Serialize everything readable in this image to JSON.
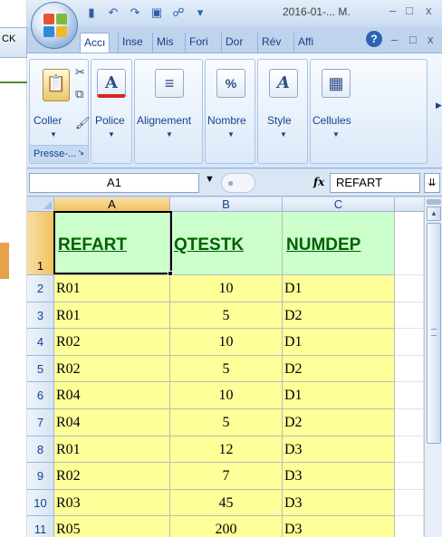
{
  "background": {
    "tab_label": "CK"
  },
  "titlebar": {
    "title": "2016-01-... M.",
    "qat_icons": [
      "save-icon",
      "undo-icon",
      "redo-icon",
      "view-icon",
      "print-preview-icon",
      "customize-icon"
    ],
    "controls": {
      "minimize": "–",
      "restore": "□",
      "close": "x"
    }
  },
  "ribbon_tabs": [
    {
      "label": "Accı",
      "active": true
    },
    {
      "label": "Inse"
    },
    {
      "label": "Mis"
    },
    {
      "label": "Fori"
    },
    {
      "label": "Dor"
    },
    {
      "label": "Rév"
    },
    {
      "label": "Affi"
    }
  ],
  "ribbon_controls": {
    "help": "?",
    "minimize": "–",
    "restore": "□",
    "close": "x"
  },
  "ribbon": {
    "paste_label": "Coller",
    "clipboard_label": "Presse-...",
    "police_label": "Police",
    "alignement_label": "Alignement",
    "nombre_label": "Nombre",
    "style_label": "Style",
    "cellules_label": "Cellules"
  },
  "formula_bar": {
    "name_box": "A1",
    "fx": "fx",
    "value": "REFART"
  },
  "sheet": {
    "columns": [
      "A",
      "B",
      "C"
    ],
    "selected_cell": "A1",
    "header_row": {
      "row": "1",
      "cells": [
        "REFART",
        "QTESTK",
        "NUMDEP"
      ]
    },
    "rows": [
      {
        "row": "2",
        "cells": [
          "R01",
          "10",
          "D1"
        ]
      },
      {
        "row": "3",
        "cells": [
          "R01",
          "5",
          "D2"
        ]
      },
      {
        "row": "4",
        "cells": [
          "R02",
          "10",
          "D1"
        ]
      },
      {
        "row": "5",
        "cells": [
          "R02",
          "5",
          "D2"
        ]
      },
      {
        "row": "6",
        "cells": [
          "R04",
          "10",
          "D1"
        ]
      },
      {
        "row": "7",
        "cells": [
          "R04",
          "5",
          "D2"
        ]
      },
      {
        "row": "8",
        "cells": [
          "R01",
          "12",
          "D3"
        ]
      },
      {
        "row": "9",
        "cells": [
          "R02",
          "7",
          "D3"
        ]
      },
      {
        "row": "10",
        "cells": [
          "R03",
          "45",
          "D3"
        ]
      },
      {
        "row": "11",
        "cells": [
          "R05",
          "200",
          "D3"
        ]
      }
    ]
  },
  "colors": {
    "header_fill": "#ccffcc",
    "header_text": "#006100",
    "data_fill": "#ffff99",
    "ribbon_text": "#15428b"
  }
}
